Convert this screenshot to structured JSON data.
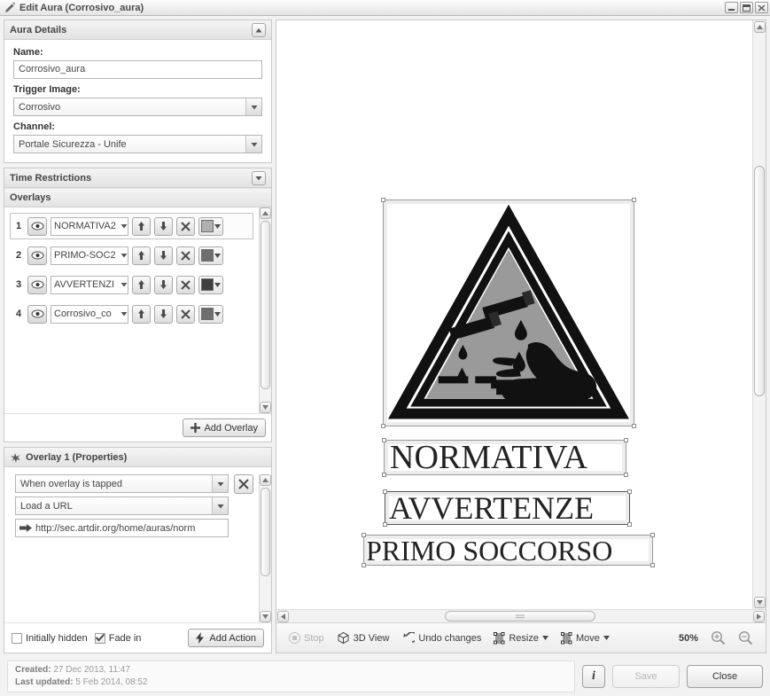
{
  "window": {
    "title": "Edit Aura (Corrosivo_aura)",
    "icon": "pencil-icon",
    "controls": {
      "minimize": "minimize-icon",
      "maximize": "maximize-icon",
      "close": "close-icon"
    }
  },
  "aura_details": {
    "header": "Aura Details",
    "collapse_icon": "chevron-up-icon",
    "name_label": "Name:",
    "name_value": "Corrosivo_aura",
    "trigger_label": "Trigger Image:",
    "trigger_value": "Corrosivo",
    "channel_label": "Channel:",
    "channel_value": "Portale Sicurezza - Unife"
  },
  "time_restrictions": {
    "header": "Time Restrictions",
    "collapse_icon": "chevron-down-icon"
  },
  "overlays": {
    "header": "Overlays",
    "add_label": "Add Overlay",
    "add_icon": "plus-icon",
    "rows": [
      {
        "num": "1",
        "name": "NORMATIVA2",
        "color": "#b0b0b0",
        "selected": true,
        "eye_icon": "eye-icon",
        "up_icon": "arrow-up-icon",
        "down_icon": "arrow-down-icon",
        "delete_icon": "x-icon",
        "swatch_icon": "color-swatch-icon"
      },
      {
        "num": "2",
        "name": "PRIMO-SOC2",
        "color": "#6e6e6e",
        "selected": false,
        "eye_icon": "eye-icon",
        "up_icon": "arrow-up-icon",
        "down_icon": "arrow-down-icon",
        "delete_icon": "x-icon",
        "swatch_icon": "color-swatch-icon"
      },
      {
        "num": "3",
        "name": "AVVERTENZI",
        "color": "#3f3f3f",
        "selected": false,
        "eye_icon": "eye-icon",
        "up_icon": "arrow-up-icon",
        "down_icon": "arrow-down-icon",
        "delete_icon": "x-icon",
        "swatch_icon": "color-swatch-icon"
      },
      {
        "num": "4",
        "name": "Corrosivo_co",
        "color": "#6e6e6e",
        "selected": false,
        "eye_icon": "eye-icon",
        "up_icon": "arrow-up-icon",
        "down_icon": "arrow-down-icon",
        "delete_icon": "x-icon",
        "swatch_icon": "color-swatch-icon"
      }
    ]
  },
  "properties": {
    "header": "Overlay 1 (Properties)",
    "header_icon": "sparkle-icon",
    "trigger_value": "When overlay is tapped",
    "action_value": "Load a URL",
    "url_value": "http://sec.artdir.org/home/auras/norm",
    "url_icon": "arrow-right-icon",
    "remove_icon": "x-icon",
    "initially_hidden_label": "Initially hidden",
    "initially_hidden_checked": false,
    "fade_in_label": "Fade in",
    "fade_in_checked": true,
    "add_action_label": "Add Action",
    "add_action_icon": "lightning-icon"
  },
  "toolbar": {
    "stop_label": "Stop",
    "stop_icon": "stop-icon",
    "stop_disabled": true,
    "view3d_label": "3D View",
    "view3d_icon": "cube-icon",
    "undo_label": "Undo changes",
    "undo_icon": "undo-icon",
    "resize_label": "Resize",
    "resize_icon": "resize-icon",
    "move_label": "Move",
    "move_icon": "move-icon",
    "zoom_level": "50%",
    "zoom_in_icon": "zoom-in-icon",
    "zoom_out_icon": "zoom-out-icon",
    "caret_icon": "caret-down-icon"
  },
  "canvas": {
    "trigger_image_alt": "corrosive-hazard-triangle",
    "overlay_texts": [
      "NORMATIVA",
      "AVVERTENZE",
      "PRIMO SOCCORSO"
    ],
    "scroll_up_icon": "scroll-up-icon",
    "scroll_down_icon": "scroll-down-icon",
    "scroll_left_icon": "scroll-left-icon",
    "scroll_right_icon": "scroll-right-icon"
  },
  "footer": {
    "created_label": "Created:",
    "created_value": "27 Dec 2013, 11:47",
    "updated_label": "Last updated:",
    "updated_value": "5 Feb 2014, 08:52",
    "info_label": "i",
    "save_label": "Save",
    "save_disabled": true,
    "close_label": "Close"
  }
}
